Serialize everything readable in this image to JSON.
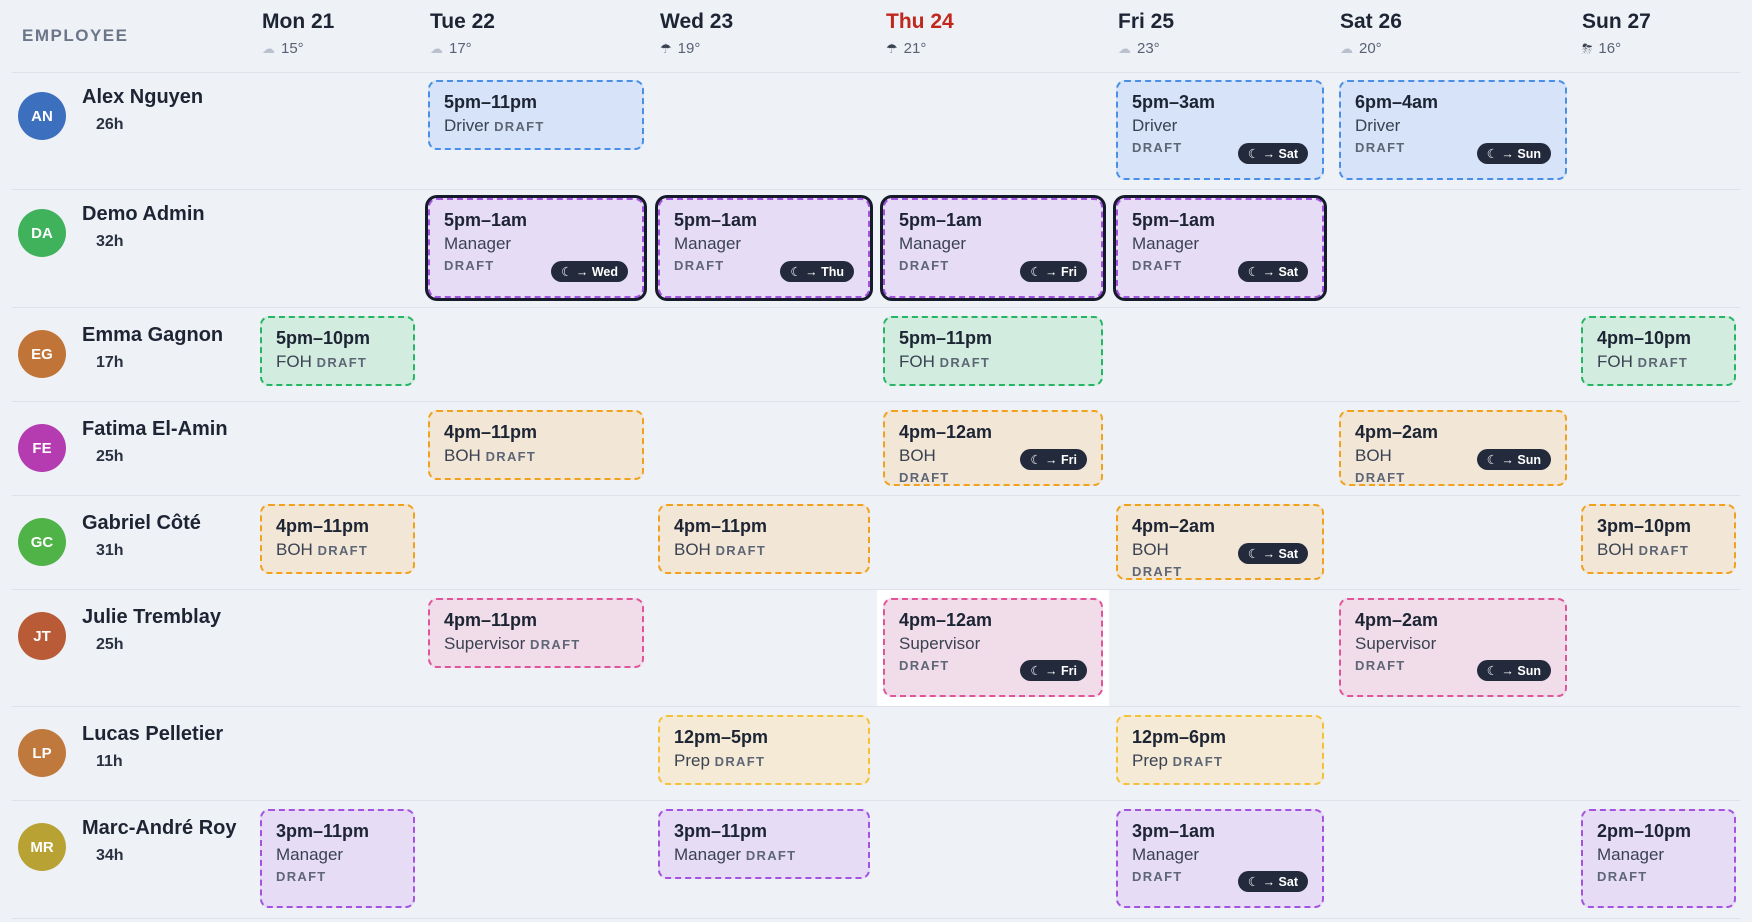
{
  "header": {
    "employee_label": "EMPLOYEE"
  },
  "days": [
    {
      "label": "Mon 21",
      "temp": "15°",
      "weather_icon": "cloud-icon",
      "today": false
    },
    {
      "label": "Tue 22",
      "temp": "17°",
      "weather_icon": "cloud-icon",
      "today": false
    },
    {
      "label": "Wed 23",
      "temp": "19°",
      "weather_icon": "rain-cloud-icon",
      "today": false
    },
    {
      "label": "Thu 24",
      "temp": "21°",
      "weather_icon": "rain-cloud-icon",
      "today": true
    },
    {
      "label": "Fri 25",
      "temp": "23°",
      "weather_icon": "cloud-icon",
      "today": false
    },
    {
      "label": "Sat 26",
      "temp": "20°",
      "weather_icon": "cloud-icon",
      "today": false
    },
    {
      "label": "Sun 27",
      "temp": "16°",
      "weather_icon": "storm-cloud-icon",
      "today": false
    }
  ],
  "role_colors": {
    "Driver": {
      "bg": "#d6e3f8",
      "border": "#4a8fe6"
    },
    "Manager": {
      "bg": "#e6dcf6",
      "border": "#a453e0"
    },
    "FOH": {
      "bg": "#d3ece0",
      "border": "#27b565"
    },
    "BOH": {
      "bg": "#f2e6d6",
      "border": "#f0a21f"
    },
    "Supervisor": {
      "bg": "#f1dcea",
      "border": "#e0559a"
    },
    "Prep": {
      "bg": "#f4ead6",
      "border": "#f4c23a"
    }
  },
  "employees": [
    {
      "initials": "AN",
      "name": "Alex Nguyen",
      "hours": "26h",
      "avatar_color": "#3d6fbf",
      "shifts": [
        {
          "day": 1,
          "time": "5pm–11pm",
          "role": "Driver",
          "draft": "DRAFT",
          "overnight": ""
        },
        {
          "day": 4,
          "time": "5pm–3am",
          "role": "Driver",
          "draft": "DRAFT",
          "overnight": "→ Sat"
        },
        {
          "day": 5,
          "time": "6pm–4am",
          "role": "Driver",
          "draft": "DRAFT",
          "overnight": "→ Sun"
        }
      ]
    },
    {
      "initials": "DA",
      "name": "Demo Admin",
      "hours": "32h",
      "avatar_color": "#3fb25b",
      "shifts": [
        {
          "day": 1,
          "time": "5pm–1am",
          "role": "Manager",
          "draft": "DRAFT",
          "overnight": "→ Wed",
          "selected": true
        },
        {
          "day": 2,
          "time": "5pm–1am",
          "role": "Manager",
          "draft": "DRAFT",
          "overnight": "→ Thu",
          "selected": true
        },
        {
          "day": 3,
          "time": "5pm–1am",
          "role": "Manager",
          "draft": "DRAFT",
          "overnight": "→ Fri",
          "selected": true
        },
        {
          "day": 4,
          "time": "5pm–1am",
          "role": "Manager",
          "draft": "DRAFT",
          "overnight": "→ Sat",
          "selected": true
        }
      ]
    },
    {
      "initials": "EG",
      "name": "Emma Gagnon",
      "hours": "17h",
      "avatar_color": "#c07438",
      "shifts": [
        {
          "day": 0,
          "time": "5pm–10pm",
          "role": "FOH",
          "draft": "DRAFT",
          "overnight": ""
        },
        {
          "day": 3,
          "time": "5pm–11pm",
          "role": "FOH",
          "draft": "DRAFT",
          "overnight": ""
        },
        {
          "day": 6,
          "time": "4pm–10pm",
          "role": "FOH",
          "draft": "DRAFT",
          "overnight": ""
        }
      ]
    },
    {
      "initials": "FE",
      "name": "Fatima El-Amin",
      "hours": "25h",
      "avatar_color": "#b53bb0",
      "shifts": [
        {
          "day": 1,
          "time": "4pm–11pm",
          "role": "BOH",
          "draft": "DRAFT",
          "overnight": ""
        },
        {
          "day": 3,
          "time": "4pm–12am",
          "role": "BOH",
          "draft": "DRAFT",
          "overnight": "→ Fri"
        },
        {
          "day": 5,
          "time": "4pm–2am",
          "role": "BOH",
          "draft": "DRAFT",
          "overnight": "→ Sun"
        }
      ]
    },
    {
      "initials": "GC",
      "name": "Gabriel Côté",
      "hours": "31h",
      "avatar_color": "#4fb347",
      "shifts": [
        {
          "day": 0,
          "time": "4pm–11pm",
          "role": "BOH",
          "draft": "DRAFT",
          "overnight": ""
        },
        {
          "day": 2,
          "time": "4pm–11pm",
          "role": "BOH",
          "draft": "DRAFT",
          "overnight": ""
        },
        {
          "day": 4,
          "time": "4pm–2am",
          "role": "BOH",
          "draft": "DRAFT",
          "overnight": "→ Sat"
        },
        {
          "day": 6,
          "time": "3pm–10pm",
          "role": "BOH",
          "draft": "DRAFT",
          "overnight": ""
        }
      ]
    },
    {
      "initials": "JT",
      "name": "Julie Tremblay",
      "hours": "25h",
      "avatar_color": "#b85b36",
      "shifts": [
        {
          "day": 1,
          "time": "4pm–11pm",
          "role": "Supervisor",
          "draft": "DRAFT",
          "overnight": ""
        },
        {
          "day": 3,
          "time": "4pm–12am",
          "role": "Supervisor",
          "draft": "DRAFT",
          "overnight": "→ Fri"
        },
        {
          "day": 5,
          "time": "4pm–2am",
          "role": "Supervisor",
          "draft": "DRAFT",
          "overnight": "→ Sun"
        }
      ]
    },
    {
      "initials": "LP",
      "name": "Lucas Pelletier",
      "hours": "11h",
      "avatar_color": "#c0793c",
      "shifts": [
        {
          "day": 2,
          "time": "12pm–5pm",
          "role": "Prep",
          "draft": "DRAFT",
          "overnight": ""
        },
        {
          "day": 4,
          "time": "12pm–6pm",
          "role": "Prep",
          "draft": "DRAFT",
          "overnight": ""
        }
      ]
    },
    {
      "initials": "MR",
      "name": "Marc-André Roy",
      "hours": "34h",
      "avatar_color": "#b8a234",
      "shifts": [
        {
          "day": 0,
          "time": "3pm–11pm",
          "role": "Manager",
          "draft": "DRAFT",
          "overnight": ""
        },
        {
          "day": 2,
          "time": "3pm–11pm",
          "role": "Manager",
          "draft": "DRAFT",
          "overnight": ""
        },
        {
          "day": 4,
          "time": "3pm–1am",
          "role": "Manager",
          "draft": "DRAFT",
          "overnight": "→ Sat"
        },
        {
          "day": 6,
          "time": "2pm–10pm",
          "role": "Manager",
          "draft": "DRAFT",
          "overnight": ""
        }
      ]
    }
  ]
}
